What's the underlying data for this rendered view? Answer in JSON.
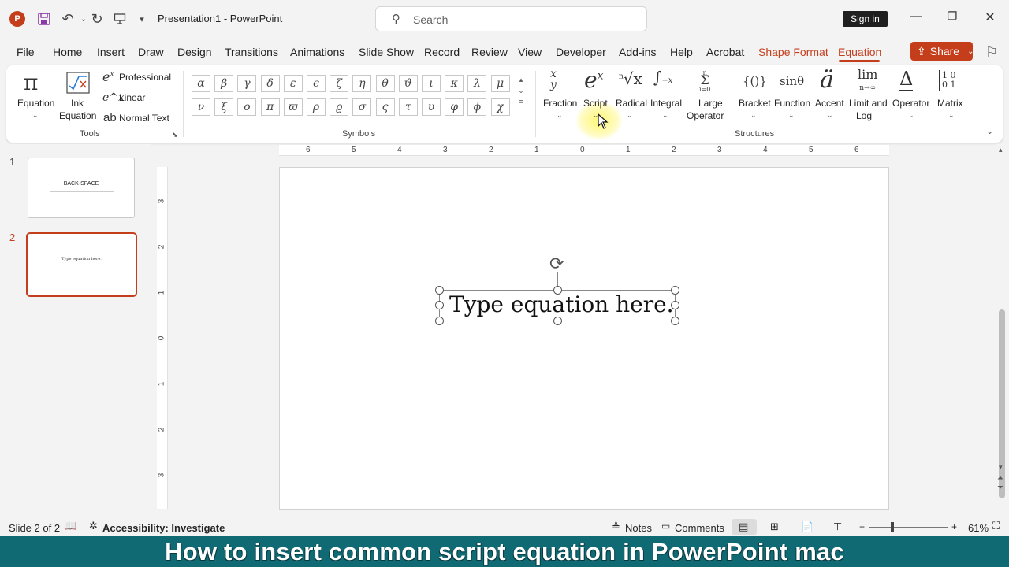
{
  "app": {
    "document_title": "Presentation1  -  PowerPoint",
    "search_placeholder": "Search",
    "sign_in_label": "Sign in"
  },
  "tabs": [
    "File",
    "Home",
    "Insert",
    "Draw",
    "Design",
    "Transitions",
    "Animations",
    "Slide Show",
    "Record",
    "Review",
    "View",
    "Developer",
    "Add-ins",
    "Help",
    "Acrobat",
    "Shape Format",
    "Equation"
  ],
  "active_tab": "Equation",
  "share_label": "Share",
  "ribbon": {
    "tools": {
      "equation_label": "Equation",
      "ink_equation_label_1": "Ink",
      "ink_equation_label_2": "Equation",
      "professional_label": "Professional",
      "linear_label": "Linear",
      "normal_text_label": "Normal Text",
      "group_label": "Tools"
    },
    "symbols": {
      "row1": [
        "α",
        "β",
        "γ",
        "δ",
        "ε",
        "ϵ",
        "ζ",
        "η",
        "θ",
        "ϑ",
        "ι",
        "κ",
        "λ",
        "μ"
      ],
      "row2": [
        "ν",
        "ξ",
        "ο",
        "π",
        "ϖ",
        "ρ",
        "ϱ",
        "σ",
        "ς",
        "τ",
        "υ",
        "φ",
        "ϕ",
        "χ"
      ],
      "group_label": "Symbols"
    },
    "structures": {
      "fraction_label": "Fraction",
      "script_label": "Script",
      "radical_label": "Radical",
      "integral_label": "Integral",
      "large_operator_label_1": "Large",
      "large_operator_label_2": "Operator",
      "bracket_label": "Bracket",
      "function_label": "Function",
      "accent_label": "Accent",
      "limit_label_1": "Limit and",
      "limit_label_2": "Log",
      "operator_label": "Operator",
      "matrix_label": "Matrix",
      "group_label": "Structures"
    }
  },
  "slides": {
    "slide1_number": "1",
    "slide1_title": "BACK-SPACE",
    "slide2_number": "2",
    "slide2_text": "Type equation here."
  },
  "canvas": {
    "equation_placeholder": "Type equation here."
  },
  "ruler_h": [
    "6",
    "5",
    "4",
    "3",
    "2",
    "1",
    "0",
    "1",
    "2",
    "3",
    "4",
    "5",
    "6"
  ],
  "ruler_v": [
    "3",
    "2",
    "1",
    "0",
    "1",
    "2",
    "3"
  ],
  "status": {
    "slide_info": "Slide 2 of 2",
    "accessibility": "Accessibility: Investigate",
    "notes_label": "Notes",
    "comments_label": "Comments",
    "zoom": "61%"
  },
  "caption": "How to insert common script equation in PowerPoint mac",
  "colors": {
    "accent": "#c43e1c",
    "caption_bg": "#0f6a74"
  }
}
